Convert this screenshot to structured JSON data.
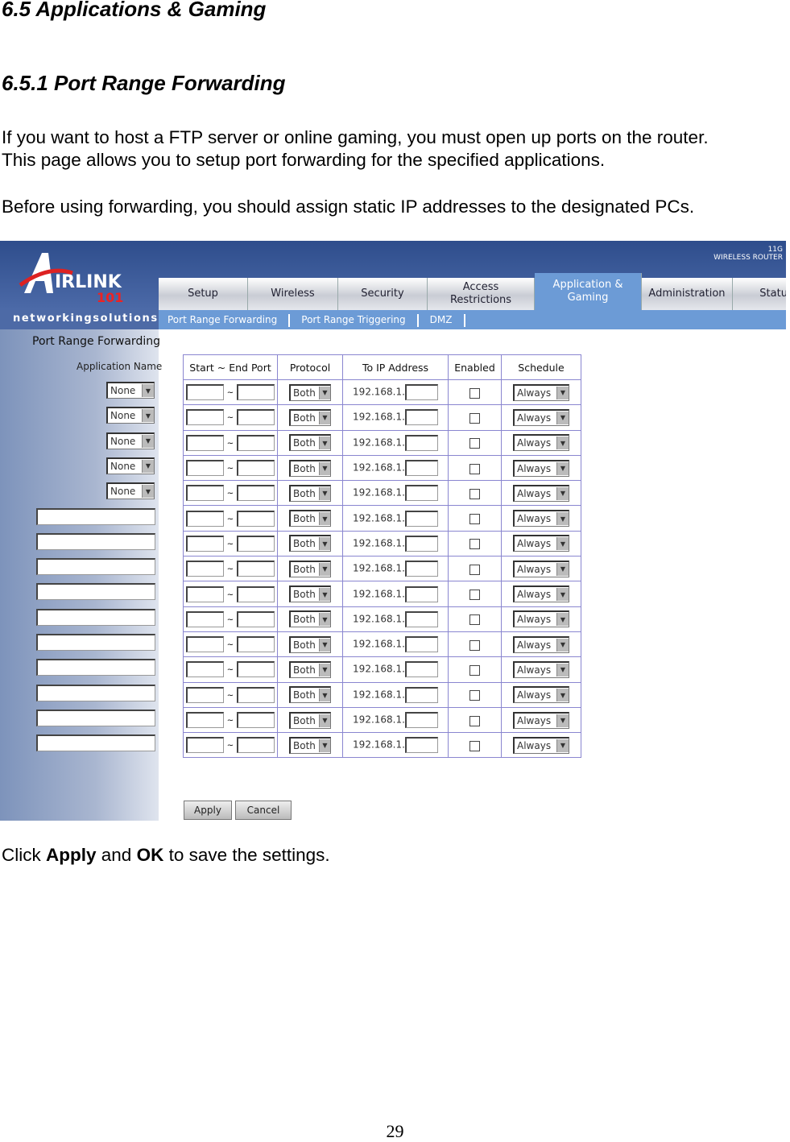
{
  "doc": {
    "heading1": "6.5 Applications & Gaming",
    "heading2": "6.5.1 Port Range Forwarding",
    "para1_line1": "If you want to host a FTP server or online gaming, you must open up ports on the router.",
    "para1_line2": "This page allows you to setup port forwarding for the specified applications.",
    "para2": "Before using forwarding, you should assign static IP addresses to the designated PCs.",
    "footer_pre": "Click ",
    "footer_b1": "Apply",
    "footer_mid": " and ",
    "footer_b2": "OK",
    "footer_post": " to save the settings.",
    "page_number": "29"
  },
  "router": {
    "logo_text": "AIRLINK 101",
    "brand": "networkingsolutions",
    "badge_line1": "11G",
    "badge_line2": "WIRELESS ROUTER",
    "tabs": [
      {
        "label": "Setup"
      },
      {
        "label": "Wireless"
      },
      {
        "label": "Security"
      },
      {
        "label": "Access Restrictions"
      },
      {
        "label": "Application & Gaming",
        "active": true
      },
      {
        "label": "Administration"
      },
      {
        "label": "Status"
      }
    ],
    "subnav": [
      "Port Range Forwarding",
      "Port Range Triggering",
      "DMZ"
    ],
    "section_title": "Port Range Forwarding",
    "app_name_label": "Application Name",
    "columns": [
      "Start ~ End Port",
      "Protocol",
      "To IP Address",
      "Enabled",
      "Schedule"
    ],
    "port_separator": "~",
    "ip_prefix": "192.168.1.",
    "protocol_value": "Both",
    "schedule_value": "Always",
    "app_select_value": "None",
    "rows": [
      {
        "app": "select"
      },
      {
        "app": "select"
      },
      {
        "app": "select"
      },
      {
        "app": "select"
      },
      {
        "app": "select"
      },
      {
        "app": "text"
      },
      {
        "app": "text"
      },
      {
        "app": "text"
      },
      {
        "app": "text"
      },
      {
        "app": "text"
      },
      {
        "app": "text"
      },
      {
        "app": "text"
      },
      {
        "app": "text"
      },
      {
        "app": "text"
      },
      {
        "app": "text"
      }
    ],
    "apply_label": "Apply",
    "cancel_label": "Cancel"
  }
}
